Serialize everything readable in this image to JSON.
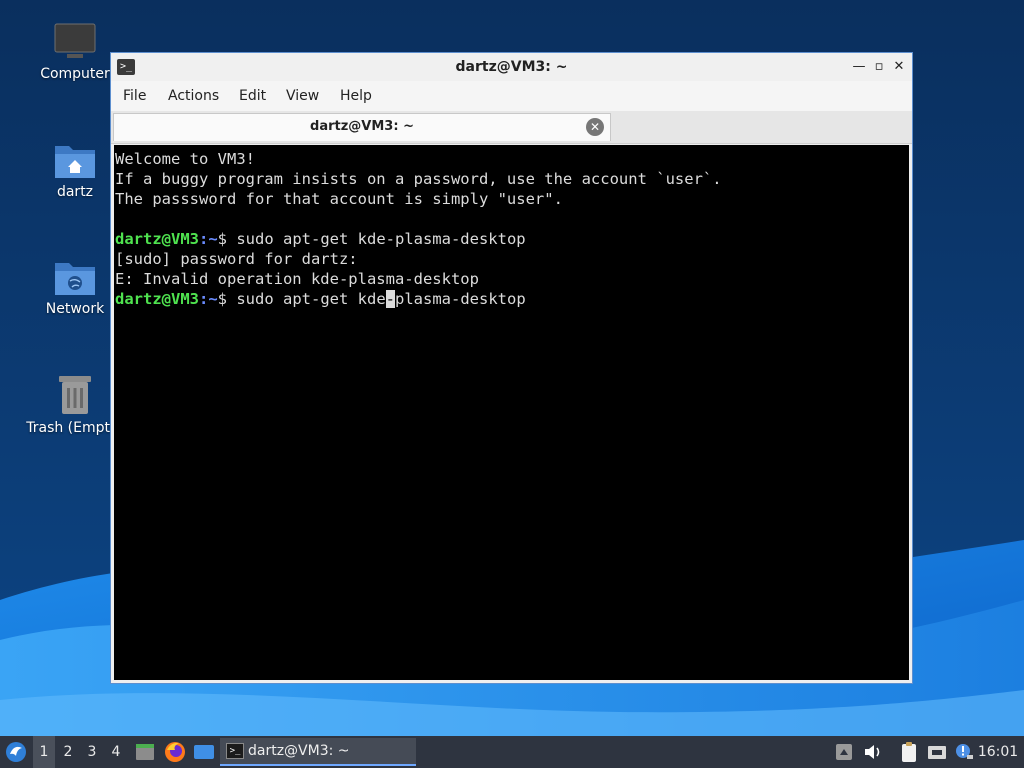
{
  "desktop": {
    "icons": [
      {
        "label": "Computer",
        "icon": "computer-monitor-icon"
      },
      {
        "label": "dartz",
        "icon": "home-folder-icon"
      },
      {
        "label": "Network",
        "icon": "network-folder-icon"
      },
      {
        "label": "Trash (Empty)",
        "icon": "trash-icon"
      }
    ]
  },
  "window": {
    "title": "dartz@VM3: ~",
    "menu": [
      "File",
      "Actions",
      "Edit",
      "View",
      "Help"
    ],
    "tab_title": "dartz@VM3: ~",
    "buttons": {
      "minimize": "—",
      "maximize": "▫",
      "close": "✕"
    }
  },
  "terminal": {
    "welcome": [
      "Welcome to VM3!",
      "If a buggy program insists on a password, use the account `user`.",
      "The passsword for that account is simply \"user\"."
    ],
    "prompt_user": "dartz@VM3",
    "prompt_path": ":~",
    "prompt_symbol": "$ ",
    "command1": "sudo apt-get kde-plasma-desktop",
    "output": [
      "[sudo] password for dartz:",
      "E: Invalid operation kde-plasma-desktop"
    ],
    "command2_before_cursor": "sudo apt-get kde",
    "command2_cursor_char": "-",
    "command2_after_cursor": "plasma-desktop"
  },
  "taskbar": {
    "workspaces": [
      "1",
      "2",
      "3",
      "4"
    ],
    "active_workspace": "1",
    "task_label": "dartz@VM3: ~",
    "clock": "16:01",
    "colors": {
      "bar": "#2e3440",
      "active_task_underline": "#6fa8ff"
    }
  },
  "colors": {
    "prompt_user": "#4fe34f",
    "prompt_path": "#6b8cff",
    "terminal_bg": "#000000",
    "terminal_fg": "#dcdcdc"
  }
}
